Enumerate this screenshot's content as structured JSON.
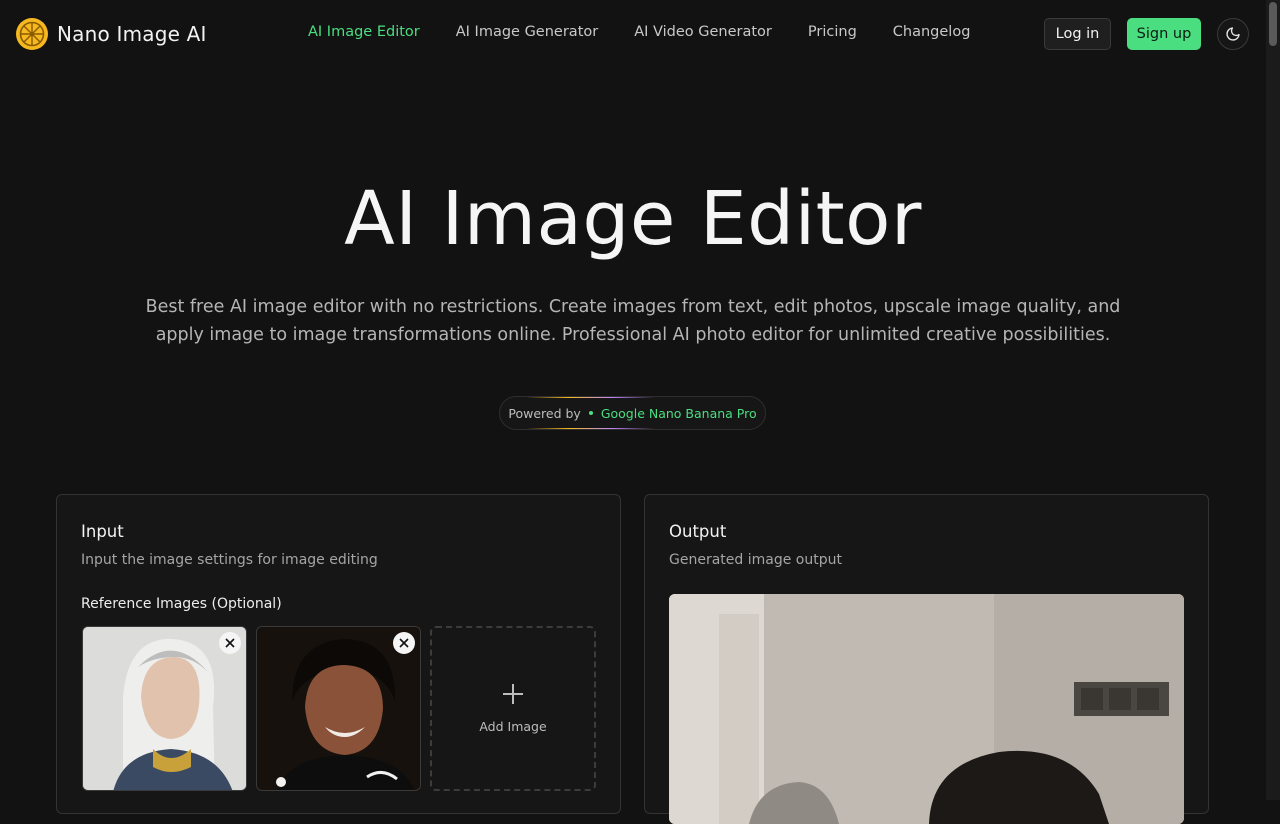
{
  "brand": {
    "name": "Nano Image AI",
    "accent": "#4ade80",
    "logo_color": "#f5b81f"
  },
  "nav": {
    "items": [
      {
        "label": "AI Image Editor",
        "active": true
      },
      {
        "label": "AI Image Generator",
        "active": false
      },
      {
        "label": "AI Video Generator",
        "active": false
      },
      {
        "label": "Pricing",
        "active": false
      },
      {
        "label": "Changelog",
        "active": false
      }
    ]
  },
  "auth": {
    "login_label": "Log in",
    "signup_label": "Sign up",
    "theme_icon": "moon-icon"
  },
  "hero": {
    "title": "AI Image Editor",
    "description": "Best free AI image editor with no restrictions. Create images from text, edit photos, upscale image quality, and apply image to image transformations online. Professional AI photo editor for unlimited creative possibilities.",
    "powered_label": "Powered by",
    "powered_model": "Google Nano Banana Pro"
  },
  "input_panel": {
    "title": "Input",
    "subtitle": "Input the image settings for image editing",
    "reference_label": "Reference Images (Optional)",
    "add_image_label": "Add Image"
  },
  "output_panel": {
    "title": "Output",
    "subtitle": "Generated image output"
  }
}
